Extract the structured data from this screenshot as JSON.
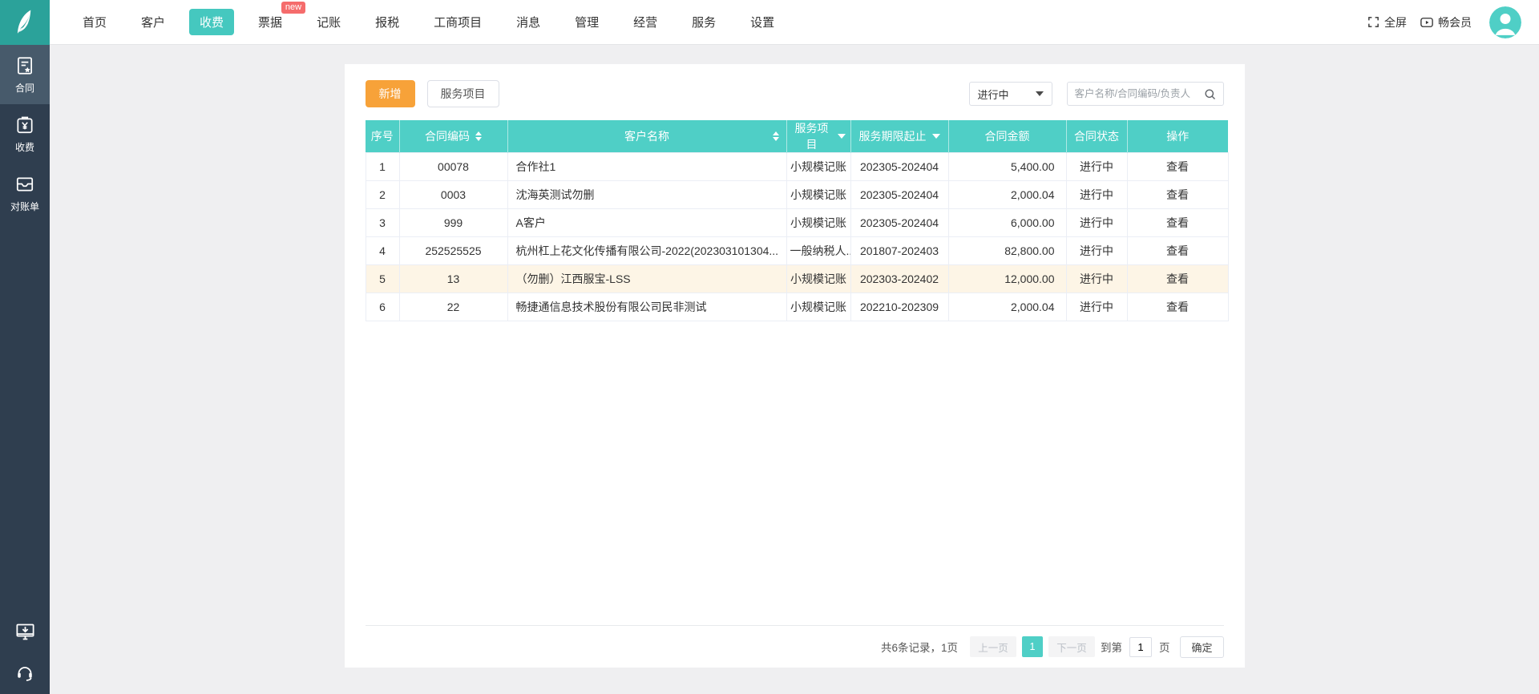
{
  "topnav": {
    "tabs": [
      {
        "name": "home",
        "label": "首页",
        "active": false
      },
      {
        "name": "customers",
        "label": "客户",
        "active": false
      },
      {
        "name": "fees",
        "label": "收费",
        "active": true
      },
      {
        "name": "invoices",
        "label": "票据",
        "active": false,
        "badge": "new"
      },
      {
        "name": "bookkeeping",
        "label": "记账",
        "active": false
      },
      {
        "name": "tax",
        "label": "报税",
        "active": false
      },
      {
        "name": "business-projects",
        "label": "工商项目",
        "active": false
      },
      {
        "name": "messages",
        "label": "消息",
        "active": false
      },
      {
        "name": "management",
        "label": "管理",
        "active": false
      },
      {
        "name": "operations",
        "label": "经营",
        "active": false
      },
      {
        "name": "services",
        "label": "服务",
        "active": false
      },
      {
        "name": "settings",
        "label": "设置",
        "active": false
      }
    ],
    "fullscreen_label": "全屏",
    "member_label": "畅会员",
    "icons": [
      "fullscreen-icon",
      "play-icon",
      "avatar"
    ]
  },
  "sidebar": {
    "items": [
      {
        "name": "contracts",
        "label": "合同",
        "icon": "contract-icon",
        "active": true
      },
      {
        "name": "fees",
        "label": "收费",
        "icon": "fee-icon",
        "active": false
      },
      {
        "name": "statements",
        "label": "对账单",
        "icon": "statement-icon",
        "active": false
      }
    ],
    "bottom_icons": [
      "client-download-icon",
      "customer-support-icon"
    ]
  },
  "toolbar": {
    "add_label": "新增",
    "service_items_label": "服务项目",
    "status_filter_value": "进行中",
    "search_placeholder": "客户名称/合同编码/负责人"
  },
  "table": {
    "columns": [
      {
        "label": "序号",
        "sort": false,
        "filter": false
      },
      {
        "label": "合同编码",
        "sort": true,
        "filter": false
      },
      {
        "label": "客户名称",
        "sort": true,
        "filter": false
      },
      {
        "label": "服务项目",
        "sort": false,
        "filter": true
      },
      {
        "label": "服务期限起止",
        "sort": false,
        "filter": true
      },
      {
        "label": "合同金额",
        "sort": false,
        "filter": false
      },
      {
        "label": "合同状态",
        "sort": false,
        "filter": false
      },
      {
        "label": "操作",
        "sort": false,
        "filter": false
      }
    ],
    "rows": [
      {
        "index": "1",
        "code": "00078",
        "customer": "合作社1",
        "service": "小规模记账",
        "period": "202305-202404",
        "amount": "5,400.00",
        "status": "进行中",
        "action": "查看",
        "highlight": false
      },
      {
        "index": "2",
        "code": "0003",
        "customer": "沈海英测试勿删",
        "service": "小规模记账",
        "period": "202305-202404",
        "amount": "2,000.04",
        "status": "进行中",
        "action": "查看",
        "highlight": false
      },
      {
        "index": "3",
        "code": "999",
        "customer": "A客户",
        "service": "小规模记账",
        "period": "202305-202404",
        "amount": "6,000.00",
        "status": "进行中",
        "action": "查看",
        "highlight": false
      },
      {
        "index": "4",
        "code": "252525525",
        "customer": "杭州杠上花文化传播有限公司-2022(202303101304...",
        "service": "一般纳税人...",
        "period": "201807-202403",
        "amount": "82,800.00",
        "status": "进行中",
        "action": "查看",
        "highlight": false
      },
      {
        "index": "5",
        "code": "13",
        "customer": "（勿删）江西服宝-LSS",
        "service": "小规模记账",
        "period": "202303-202402",
        "amount": "12,000.00",
        "status": "进行中",
        "action": "查看",
        "highlight": true
      },
      {
        "index": "6",
        "code": "22",
        "customer": "畅捷通信息技术股份有限公司民非测试",
        "service": "小规模记账",
        "period": "202210-202309",
        "amount": "2,000.04",
        "status": "进行中",
        "action": "查看",
        "highlight": false
      }
    ]
  },
  "pagination": {
    "summary": "共6条记录，1页",
    "prev_label": "上一页",
    "current_page": "1",
    "next_label": "下一页",
    "goto_prefix": "到第",
    "goto_value": "1",
    "goto_suffix": "页",
    "confirm_label": "确定"
  },
  "colors": {
    "accent_teal": "#4fcfc6",
    "active_tab_teal": "#45c8bf",
    "logo_teal": "#2ba29a",
    "button_orange": "#f7a239",
    "badge_red": "#f56c6c",
    "sidebar_bg": "#2f3e4f",
    "sidebar_active_bg": "#475a6b",
    "row_highlight": "#fdf5e6"
  }
}
